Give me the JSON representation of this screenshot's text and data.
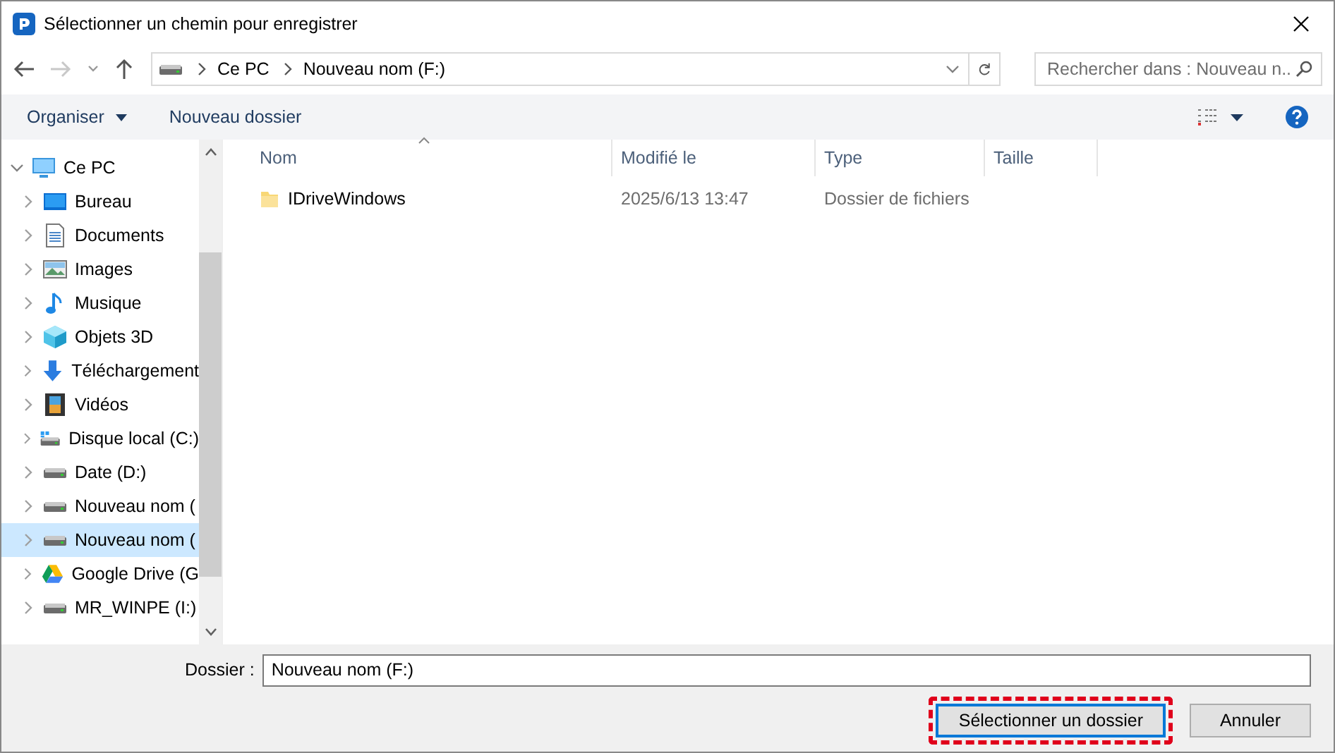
{
  "window": {
    "title": "Sélectionner un chemin pour enregistrer"
  },
  "address_bar": {
    "path": [
      "Ce PC",
      "Nouveau nom (F:)"
    ]
  },
  "search": {
    "placeholder": "Rechercher dans : Nouveau n..."
  },
  "toolbar": {
    "organize": "Organiser",
    "new_folder": "Nouveau dossier"
  },
  "sidebar": {
    "items": [
      {
        "label": "Ce PC",
        "kind": "pc",
        "expanded": true,
        "selected": false,
        "children": [
          {
            "label": "Bureau",
            "kind": "desktop",
            "selected": false
          },
          {
            "label": "Documents",
            "kind": "documents",
            "selected": false
          },
          {
            "label": "Images",
            "kind": "images",
            "selected": false
          },
          {
            "label": "Musique",
            "kind": "music",
            "selected": false
          },
          {
            "label": "Objets 3D",
            "kind": "objects3d",
            "selected": false
          },
          {
            "label": "Téléchargement",
            "kind": "downloads",
            "selected": false
          },
          {
            "label": "Vidéos",
            "kind": "videos",
            "selected": false
          },
          {
            "label": "Disque local (C:)",
            "kind": "system-drive",
            "selected": false
          },
          {
            "label": "Date (D:)",
            "kind": "drive",
            "selected": false
          },
          {
            "label": "Nouveau nom (",
            "kind": "drive",
            "selected": false
          },
          {
            "label": "Nouveau nom (",
            "kind": "drive",
            "selected": true
          },
          {
            "label": "Google Drive (G",
            "kind": "gdrive",
            "selected": false
          },
          {
            "label": "MR_WINPE (I:)",
            "kind": "drive",
            "selected": false
          }
        ]
      }
    ]
  },
  "table": {
    "columns": [
      {
        "label": "Nom",
        "sorted": true
      },
      {
        "label": "Modifié le",
        "sorted": false
      },
      {
        "label": "Type",
        "sorted": false
      },
      {
        "label": "Taille",
        "sorted": false
      }
    ],
    "rows": [
      {
        "name": "IDriveWindows",
        "modified": "2025/6/13 13:47",
        "type": "Dossier de fichiers"
      }
    ]
  },
  "folder_field": {
    "label": "Dossier :",
    "value": "Nouveau nom (F:)"
  },
  "buttons": [
    {
      "label": "Sélectionner un dossier",
      "highlighted": true
    },
    {
      "label": "Annuler",
      "highlighted": false
    }
  ]
}
